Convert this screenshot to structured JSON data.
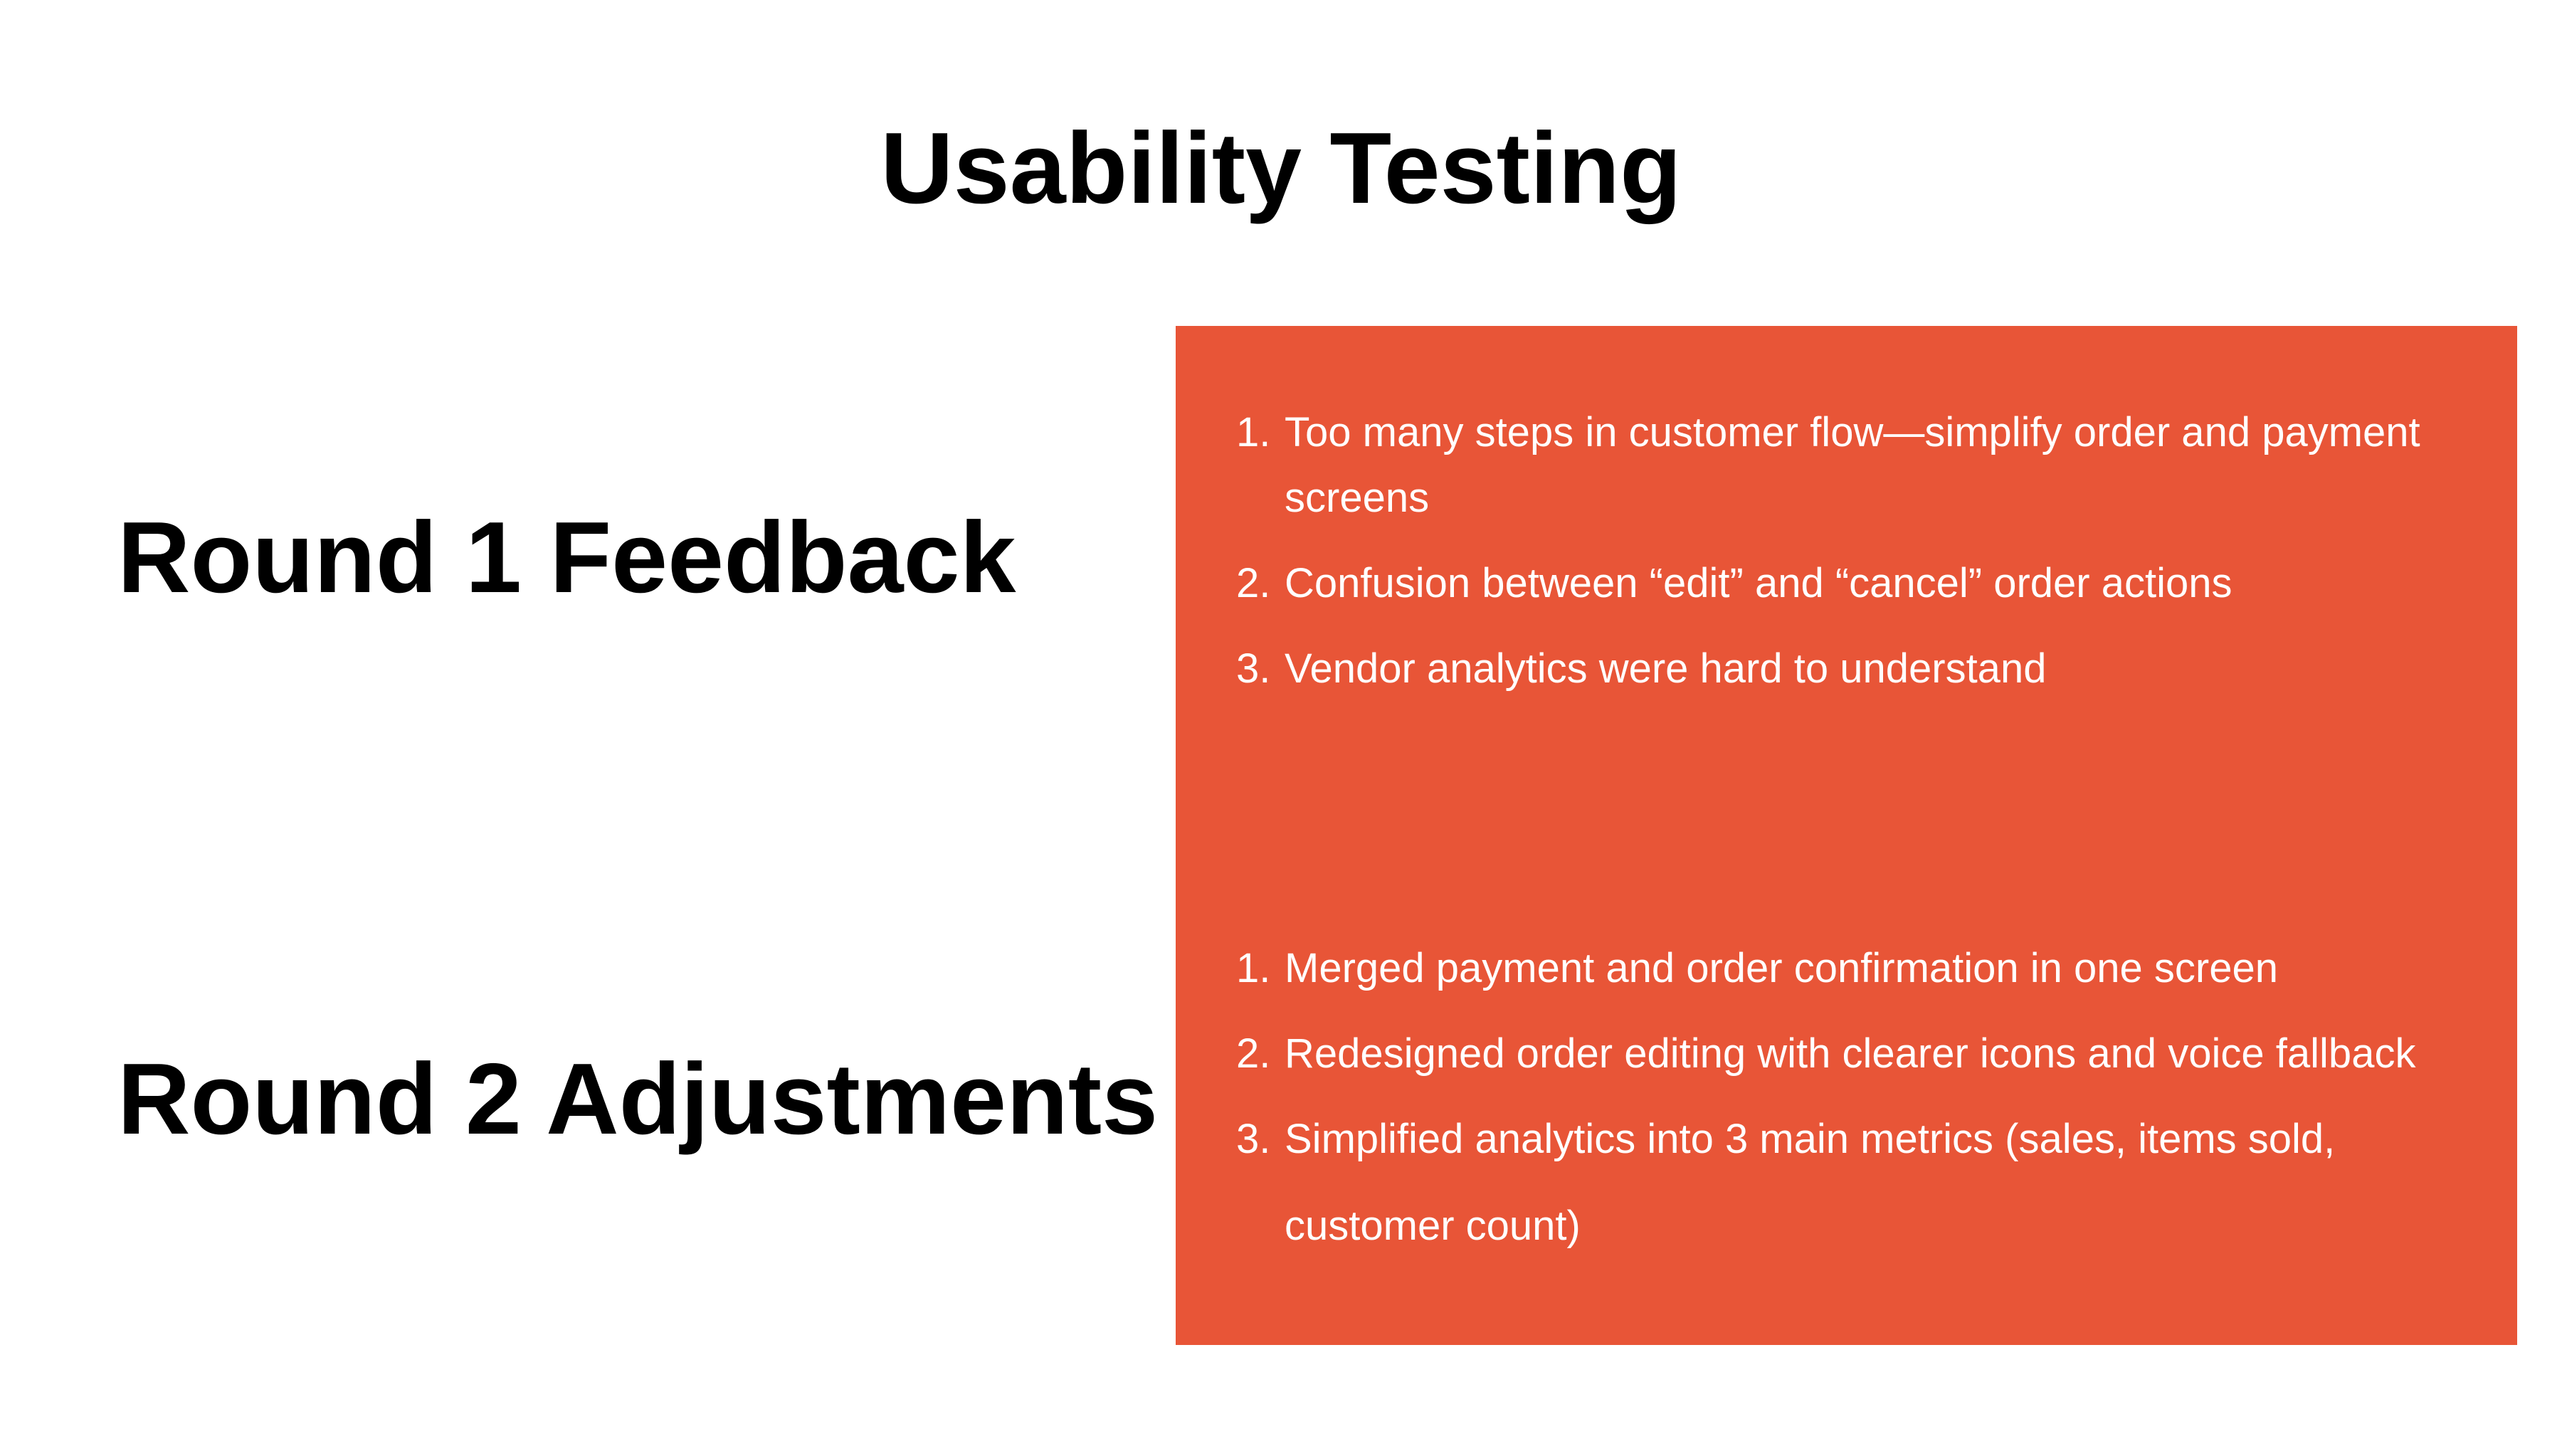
{
  "title": "Usability Testing",
  "sections": [
    {
      "heading": "Round 1 Feedback",
      "items": [
        {
          "number": "1.",
          "text": "Too many steps in customer flow—simplify order and payment screens"
        },
        {
          "number": "2.",
          "text": "Confusion between “edit” and “cancel” order actions"
        },
        {
          "number": "3.",
          "text": "Vendor analytics were hard to understand"
        }
      ]
    },
    {
      "heading": "Round 2 Adjustments",
      "items": [
        {
          "number": "1.",
          "text": "Merged payment and order confirmation in one screen"
        },
        {
          "number": "2.",
          "text": "Redesigned order editing with clearer icons and voice fallback"
        },
        {
          "number": "3.",
          "text": "Simplified analytics into 3 main metrics (sales, items sold, customer count)"
        }
      ]
    }
  ],
  "colors": {
    "panel": "#e85537",
    "heading_text": "#000000",
    "list_text": "#ffffff",
    "background": "#ffffff"
  }
}
